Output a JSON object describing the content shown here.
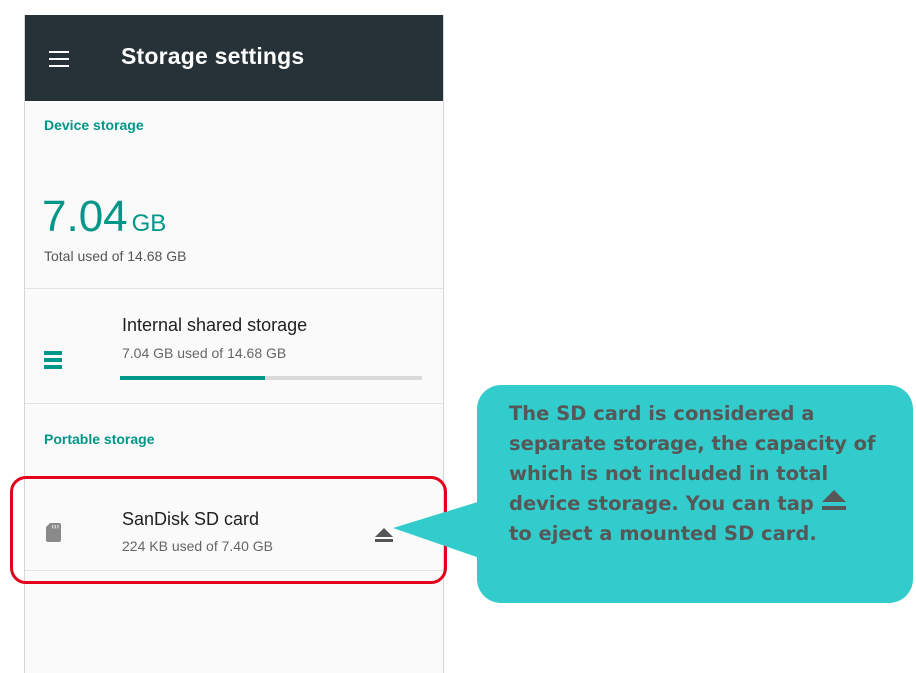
{
  "toolbar": {
    "menu_icon": "menu-icon",
    "title": "Storage settings",
    "background": "#263238"
  },
  "device_storage": {
    "section_title": "Device storage",
    "used_value": "7.04",
    "used_unit": "GB",
    "total_text": "Total used of 14.68 GB"
  },
  "internal_storage": {
    "icon": "storage-list-icon",
    "title": "Internal shared storage",
    "subtitle": "7.04 GB used of 14.68 GB",
    "used_fraction": 0.4796
  },
  "portable_storage": {
    "section_title": "Portable storage",
    "sd_card": {
      "icon": "sd-card-icon",
      "title": "SanDisk SD card",
      "subtitle": "224 KB used of 7.40 GB",
      "action_icon": "eject-icon"
    }
  },
  "callout": {
    "text_before_icon": "The SD card is considered a separate storage, the capacity of which is not included in total device storage. You can tap",
    "icon": "eject-icon",
    "text_after_icon": "to eject a mounted SD card."
  },
  "colors": {
    "accent": "#009688",
    "highlight": "#e2001a",
    "callout_bg": "#33cccc",
    "callout_text": "#575757"
  }
}
